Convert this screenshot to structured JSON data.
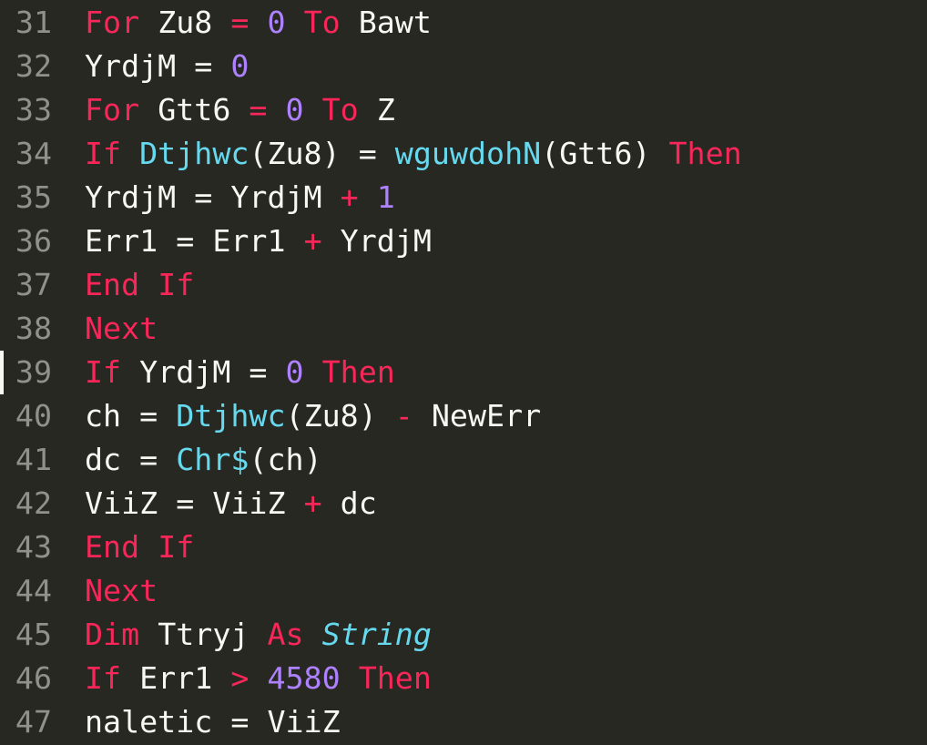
{
  "editor": {
    "current_line_index": 8,
    "lines": [
      {
        "number": 31,
        "tokens": [
          {
            "cls": "tok-kw",
            "t": "For"
          },
          {
            "cls": "tok-ws",
            "t": " "
          },
          {
            "cls": "tok-id",
            "t": "Zu8"
          },
          {
            "cls": "tok-ws",
            "t": " "
          },
          {
            "cls": "tok-op",
            "t": "="
          },
          {
            "cls": "tok-ws",
            "t": " "
          },
          {
            "cls": "tok-num",
            "t": "0"
          },
          {
            "cls": "tok-ws",
            "t": " "
          },
          {
            "cls": "tok-kw",
            "t": "To"
          },
          {
            "cls": "tok-ws",
            "t": " "
          },
          {
            "cls": "tok-id",
            "t": "Bawt"
          }
        ]
      },
      {
        "number": 32,
        "tokens": [
          {
            "cls": "tok-id",
            "t": "YrdjM"
          },
          {
            "cls": "tok-ws",
            "t": " "
          },
          {
            "cls": "tok-eq",
            "t": "="
          },
          {
            "cls": "tok-ws",
            "t": " "
          },
          {
            "cls": "tok-num",
            "t": "0"
          }
        ]
      },
      {
        "number": 33,
        "tokens": [
          {
            "cls": "tok-kw",
            "t": "For"
          },
          {
            "cls": "tok-ws",
            "t": " "
          },
          {
            "cls": "tok-id",
            "t": "Gtt6"
          },
          {
            "cls": "tok-ws",
            "t": " "
          },
          {
            "cls": "tok-op",
            "t": "="
          },
          {
            "cls": "tok-ws",
            "t": " "
          },
          {
            "cls": "tok-num",
            "t": "0"
          },
          {
            "cls": "tok-ws",
            "t": " "
          },
          {
            "cls": "tok-kw",
            "t": "To"
          },
          {
            "cls": "tok-ws",
            "t": " "
          },
          {
            "cls": "tok-id",
            "t": "Z"
          }
        ]
      },
      {
        "number": 34,
        "tokens": [
          {
            "cls": "tok-kw",
            "t": "If"
          },
          {
            "cls": "tok-ws",
            "t": " "
          },
          {
            "cls": "tok-fn",
            "t": "Dtjhwc"
          },
          {
            "cls": "tok-pun",
            "t": "("
          },
          {
            "cls": "tok-id",
            "t": "Zu8"
          },
          {
            "cls": "tok-pun",
            "t": ")"
          },
          {
            "cls": "tok-ws",
            "t": " "
          },
          {
            "cls": "tok-eq",
            "t": "="
          },
          {
            "cls": "tok-ws",
            "t": " "
          },
          {
            "cls": "tok-fn",
            "t": "wguwdohN"
          },
          {
            "cls": "tok-pun",
            "t": "("
          },
          {
            "cls": "tok-id",
            "t": "Gtt6"
          },
          {
            "cls": "tok-pun",
            "t": ")"
          },
          {
            "cls": "tok-ws",
            "t": " "
          },
          {
            "cls": "tok-kw",
            "t": "Then"
          }
        ]
      },
      {
        "number": 35,
        "tokens": [
          {
            "cls": "tok-id",
            "t": "YrdjM"
          },
          {
            "cls": "tok-ws",
            "t": " "
          },
          {
            "cls": "tok-eq",
            "t": "="
          },
          {
            "cls": "tok-ws",
            "t": " "
          },
          {
            "cls": "tok-id",
            "t": "YrdjM"
          },
          {
            "cls": "tok-ws",
            "t": " "
          },
          {
            "cls": "tok-op",
            "t": "+"
          },
          {
            "cls": "tok-ws",
            "t": " "
          },
          {
            "cls": "tok-num",
            "t": "1"
          }
        ]
      },
      {
        "number": 36,
        "tokens": [
          {
            "cls": "tok-id",
            "t": "Err1"
          },
          {
            "cls": "tok-ws",
            "t": " "
          },
          {
            "cls": "tok-eq",
            "t": "="
          },
          {
            "cls": "tok-ws",
            "t": " "
          },
          {
            "cls": "tok-id",
            "t": "Err1"
          },
          {
            "cls": "tok-ws",
            "t": " "
          },
          {
            "cls": "tok-op",
            "t": "+"
          },
          {
            "cls": "tok-ws",
            "t": " "
          },
          {
            "cls": "tok-id",
            "t": "YrdjM"
          }
        ]
      },
      {
        "number": 37,
        "tokens": [
          {
            "cls": "tok-kw",
            "t": "End"
          },
          {
            "cls": "tok-ws",
            "t": " "
          },
          {
            "cls": "tok-kw",
            "t": "If"
          }
        ]
      },
      {
        "number": 38,
        "tokens": [
          {
            "cls": "tok-kw",
            "t": "Next"
          }
        ]
      },
      {
        "number": 39,
        "tokens": [
          {
            "cls": "tok-kw",
            "t": "If"
          },
          {
            "cls": "tok-ws",
            "t": " "
          },
          {
            "cls": "tok-id",
            "t": "YrdjM"
          },
          {
            "cls": "tok-ws",
            "t": " "
          },
          {
            "cls": "tok-eq",
            "t": "="
          },
          {
            "cls": "tok-ws",
            "t": " "
          },
          {
            "cls": "tok-num",
            "t": "0"
          },
          {
            "cls": "tok-ws",
            "t": " "
          },
          {
            "cls": "tok-kw",
            "t": "Then"
          }
        ]
      },
      {
        "number": 40,
        "tokens": [
          {
            "cls": "tok-id",
            "t": "ch"
          },
          {
            "cls": "tok-ws",
            "t": " "
          },
          {
            "cls": "tok-eq",
            "t": "="
          },
          {
            "cls": "tok-ws",
            "t": " "
          },
          {
            "cls": "tok-fn",
            "t": "Dtjhwc"
          },
          {
            "cls": "tok-pun",
            "t": "("
          },
          {
            "cls": "tok-id",
            "t": "Zu8"
          },
          {
            "cls": "tok-pun",
            "t": ")"
          },
          {
            "cls": "tok-ws",
            "t": " "
          },
          {
            "cls": "tok-op",
            "t": "-"
          },
          {
            "cls": "tok-ws",
            "t": " "
          },
          {
            "cls": "tok-id",
            "t": "NewErr"
          }
        ]
      },
      {
        "number": 41,
        "tokens": [
          {
            "cls": "tok-id",
            "t": "dc"
          },
          {
            "cls": "tok-ws",
            "t": " "
          },
          {
            "cls": "tok-eq",
            "t": "="
          },
          {
            "cls": "tok-ws",
            "t": " "
          },
          {
            "cls": "tok-fn",
            "t": "Chr$"
          },
          {
            "cls": "tok-pun",
            "t": "("
          },
          {
            "cls": "tok-id",
            "t": "ch"
          },
          {
            "cls": "tok-pun",
            "t": ")"
          }
        ]
      },
      {
        "number": 42,
        "tokens": [
          {
            "cls": "tok-id",
            "t": "ViiZ"
          },
          {
            "cls": "tok-ws",
            "t": " "
          },
          {
            "cls": "tok-eq",
            "t": "="
          },
          {
            "cls": "tok-ws",
            "t": " "
          },
          {
            "cls": "tok-id",
            "t": "ViiZ"
          },
          {
            "cls": "tok-ws",
            "t": " "
          },
          {
            "cls": "tok-op",
            "t": "+"
          },
          {
            "cls": "tok-ws",
            "t": " "
          },
          {
            "cls": "tok-id",
            "t": "dc"
          }
        ]
      },
      {
        "number": 43,
        "tokens": [
          {
            "cls": "tok-kw",
            "t": "End"
          },
          {
            "cls": "tok-ws",
            "t": " "
          },
          {
            "cls": "tok-kw",
            "t": "If"
          }
        ]
      },
      {
        "number": 44,
        "tokens": [
          {
            "cls": "tok-kw",
            "t": "Next"
          }
        ]
      },
      {
        "number": 45,
        "tokens": [
          {
            "cls": "tok-kw",
            "t": "Dim"
          },
          {
            "cls": "tok-ws",
            "t": " "
          },
          {
            "cls": "tok-id",
            "t": "Ttryj"
          },
          {
            "cls": "tok-ws",
            "t": " "
          },
          {
            "cls": "tok-kw",
            "t": "As"
          },
          {
            "cls": "tok-ws",
            "t": " "
          },
          {
            "cls": "tok-type",
            "t": "String"
          }
        ]
      },
      {
        "number": 46,
        "tokens": [
          {
            "cls": "tok-kw",
            "t": "If"
          },
          {
            "cls": "tok-ws",
            "t": " "
          },
          {
            "cls": "tok-id",
            "t": "Err1"
          },
          {
            "cls": "tok-ws",
            "t": " "
          },
          {
            "cls": "tok-op",
            "t": ">"
          },
          {
            "cls": "tok-ws",
            "t": " "
          },
          {
            "cls": "tok-num",
            "t": "4580"
          },
          {
            "cls": "tok-ws",
            "t": " "
          },
          {
            "cls": "tok-kw",
            "t": "Then"
          }
        ]
      },
      {
        "number": 47,
        "tokens": [
          {
            "cls": "tok-id",
            "t": "naletic"
          },
          {
            "cls": "tok-ws",
            "t": " "
          },
          {
            "cls": "tok-eq",
            "t": "="
          },
          {
            "cls": "tok-ws",
            "t": " "
          },
          {
            "cls": "tok-id",
            "t": "ViiZ"
          }
        ]
      }
    ]
  }
}
